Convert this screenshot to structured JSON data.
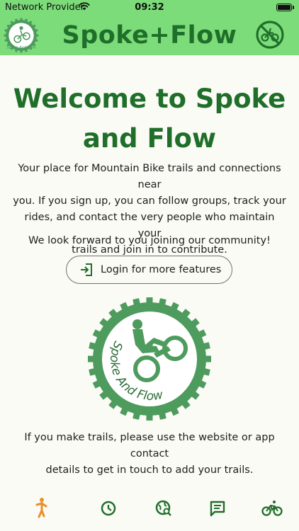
{
  "status_bar": {
    "carrier": "Network Provider",
    "time": "09:32"
  },
  "header": {
    "title": "Spoke+Flow",
    "logo_icon": "spoke-and-flow-logo",
    "action_icon": "no-bike-icon"
  },
  "welcome": {
    "line1": "Welcome to Spoke",
    "line2": "and Flow",
    "intro": [
      "Your place for Mountain Bike trails and connections near",
      "you. If you sign up, you can follow groups, track your",
      "rides, and contact the very people who maintain your",
      "trails and join in to contribute."
    ],
    "join": "We look forward to you joining our community!",
    "login_label": "Login for more features",
    "trails_note": [
      "If you make trails, please use the website or app contact",
      "details to get in touch to add your trails."
    ]
  },
  "logo_text": {
    "small": "Spoke And Flow",
    "large": "Spoke And Flow"
  },
  "tabs": [
    {
      "name": "welcome",
      "icon": "person-icon",
      "active": true
    },
    {
      "name": "history",
      "icon": "clock-icon",
      "active": false
    },
    {
      "name": "explore",
      "icon": "globe-search-icon",
      "active": false
    },
    {
      "name": "messages",
      "icon": "chat-icon",
      "active": false
    },
    {
      "name": "rides",
      "icon": "bike-icon",
      "active": false
    }
  ],
  "colors": {
    "header_bg": "#7ddc7a",
    "brand_green": "#1f6f2a",
    "logo_green": "#4e9b5e",
    "active_tab": "#e8902a"
  }
}
